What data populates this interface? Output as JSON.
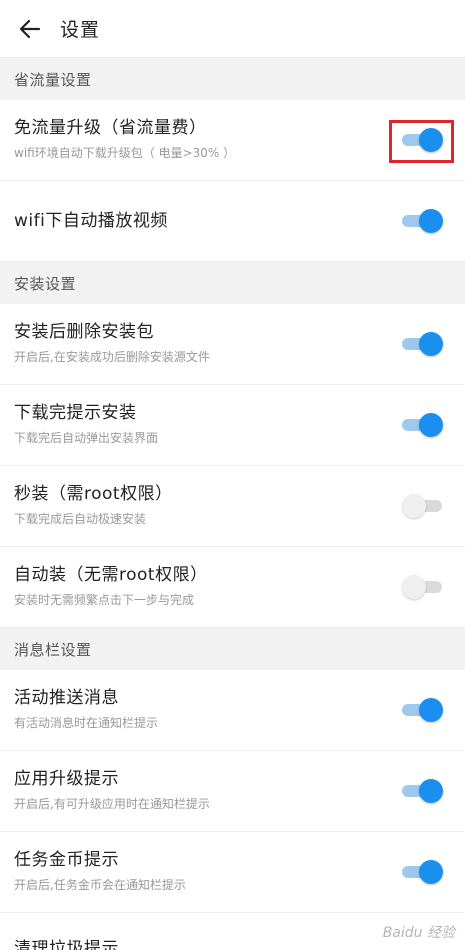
{
  "header": {
    "title": "设置"
  },
  "sections": [
    {
      "title": "省流量设置",
      "items": [
        {
          "title": "免流量升级（省流量费）",
          "subtitle": "wifi环境自动下载升级包（ 电量>30% ）",
          "enabled": true
        },
        {
          "title": "wifi下自动播放视频",
          "subtitle": "",
          "enabled": true
        }
      ]
    },
    {
      "title": "安装设置",
      "items": [
        {
          "title": "安装后删除安装包",
          "subtitle": "开启后,在安装成功后删除安装源文件",
          "enabled": true
        },
        {
          "title": "下载完提示安装",
          "subtitle": "下载完后自动弹出安装界面",
          "enabled": true
        },
        {
          "title": "秒装（需root权限）",
          "subtitle": "下载完成后自动极速安装",
          "enabled": false
        },
        {
          "title": "自动装（无需root权限）",
          "subtitle": "安装时无需频繁点击下一步与完成",
          "enabled": false
        }
      ]
    },
    {
      "title": "消息栏设置",
      "items": [
        {
          "title": "活动推送消息",
          "subtitle": "有活动消息时在通知栏提示",
          "enabled": true
        },
        {
          "title": "应用升级提示",
          "subtitle": "开启后,有可升级应用时在通知栏提示",
          "enabled": true
        },
        {
          "title": "任务金币提示",
          "subtitle": "开启后,任务金币会在通知栏提示",
          "enabled": true
        }
      ]
    }
  ],
  "partial_row": {
    "title": "清理垃圾提示"
  },
  "watermark": "Baidu 经验",
  "colors": {
    "toggle_on": "#1a8ff0",
    "toggle_track_on": "#9ec9ee",
    "toggle_off": "#efefef",
    "highlight": "#e0252b",
    "section_bg": "#f2f2f2"
  }
}
